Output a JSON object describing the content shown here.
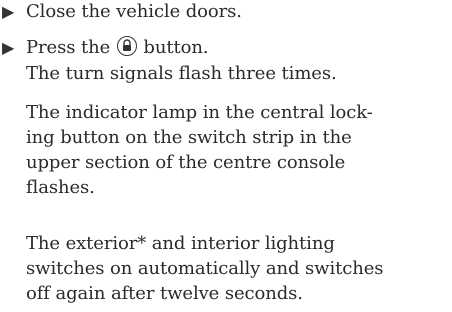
{
  "steps": [
    {
      "bullet": "▶",
      "text": "Close the vehicle doors."
    },
    {
      "bullet": "▶",
      "text_before": "Press the",
      "text_after": "button.",
      "icon": "lock-icon"
    }
  ],
  "paragraphs": [
    {
      "lines": [
        "The turn signals flash three times."
      ]
    },
    {
      "lines": [
        "The indicator lamp in the central lock-",
        "ing button on the switch strip in the",
        "upper section of the centre console",
        "flashes."
      ]
    },
    {
      "lines": [
        "The exterior* and interior lighting",
        "switches on automatically and switches",
        "off again after twelve seconds."
      ]
    }
  ]
}
